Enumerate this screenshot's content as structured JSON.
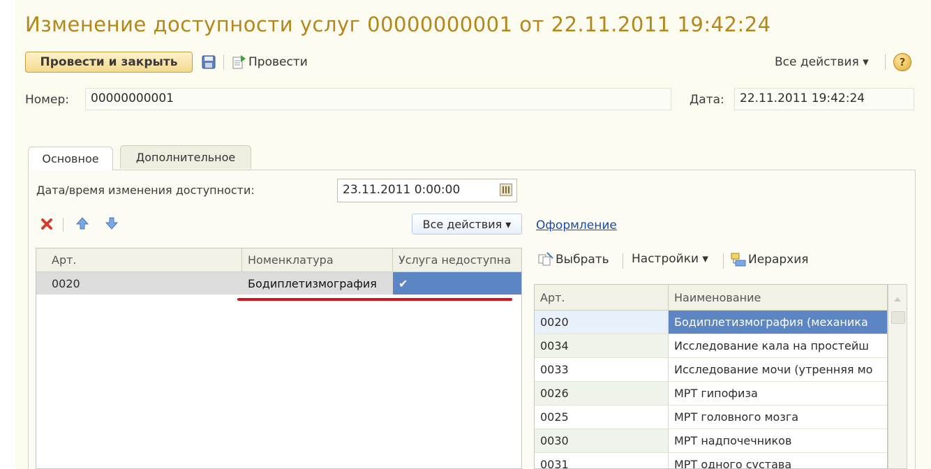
{
  "window": {
    "title": "Изменение доступности услуг 00000000001 от 22.11.2011 19:42:24"
  },
  "toolbar": {
    "post_close_label": "Провести и закрыть",
    "post_label": "Провести",
    "all_actions_label": "Все действия ▾",
    "help_label": "?"
  },
  "header": {
    "number_label": "Номер:",
    "number_value": "00000000001",
    "date_label": "Дата:",
    "date_value": "22.11.2011 19:42:24"
  },
  "tabs": [
    {
      "label": "Основное",
      "active": true
    },
    {
      "label": "Дополнительное",
      "active": false
    }
  ],
  "main": {
    "datetime_label": "Дата/время изменения доступности:",
    "datetime_value": "23.11.2011  0:00:00",
    "all_actions_label": "Все действия ▾",
    "format_link": "Оформление"
  },
  "left_table": {
    "columns": [
      "Арт.",
      "Номенклатура",
      "Услуга недоступна"
    ],
    "rows": [
      {
        "art": "0020",
        "name": "Бодиплетизмография",
        "unavailable": "✔"
      }
    ]
  },
  "right_toolbar": {
    "select_label": "Выбрать",
    "settings_label": "Настройки ▾",
    "hierarchy_label": "Иерархия"
  },
  "right_table": {
    "columns": [
      "Арт.",
      "Наименование"
    ],
    "rows": [
      {
        "art": "0020",
        "name": "Бодиплетизмография (механика"
      },
      {
        "art": "0034",
        "name": "Исследование кала на простейш"
      },
      {
        "art": "0033",
        "name": "Исследование мочи (утренняя мо"
      },
      {
        "art": "0026",
        "name": "МРТ гипофиза"
      },
      {
        "art": "0025",
        "name": "МРТ головного мозга"
      },
      {
        "art": "0030",
        "name": "МРТ надпочечников"
      },
      {
        "art": "0031",
        "name": "МРТ одного сустава"
      }
    ]
  },
  "colors": {
    "title": "#b3871a",
    "selection": "#5b85c3",
    "highlight_underline": "#d2161c",
    "link": "#1b4aa3"
  }
}
